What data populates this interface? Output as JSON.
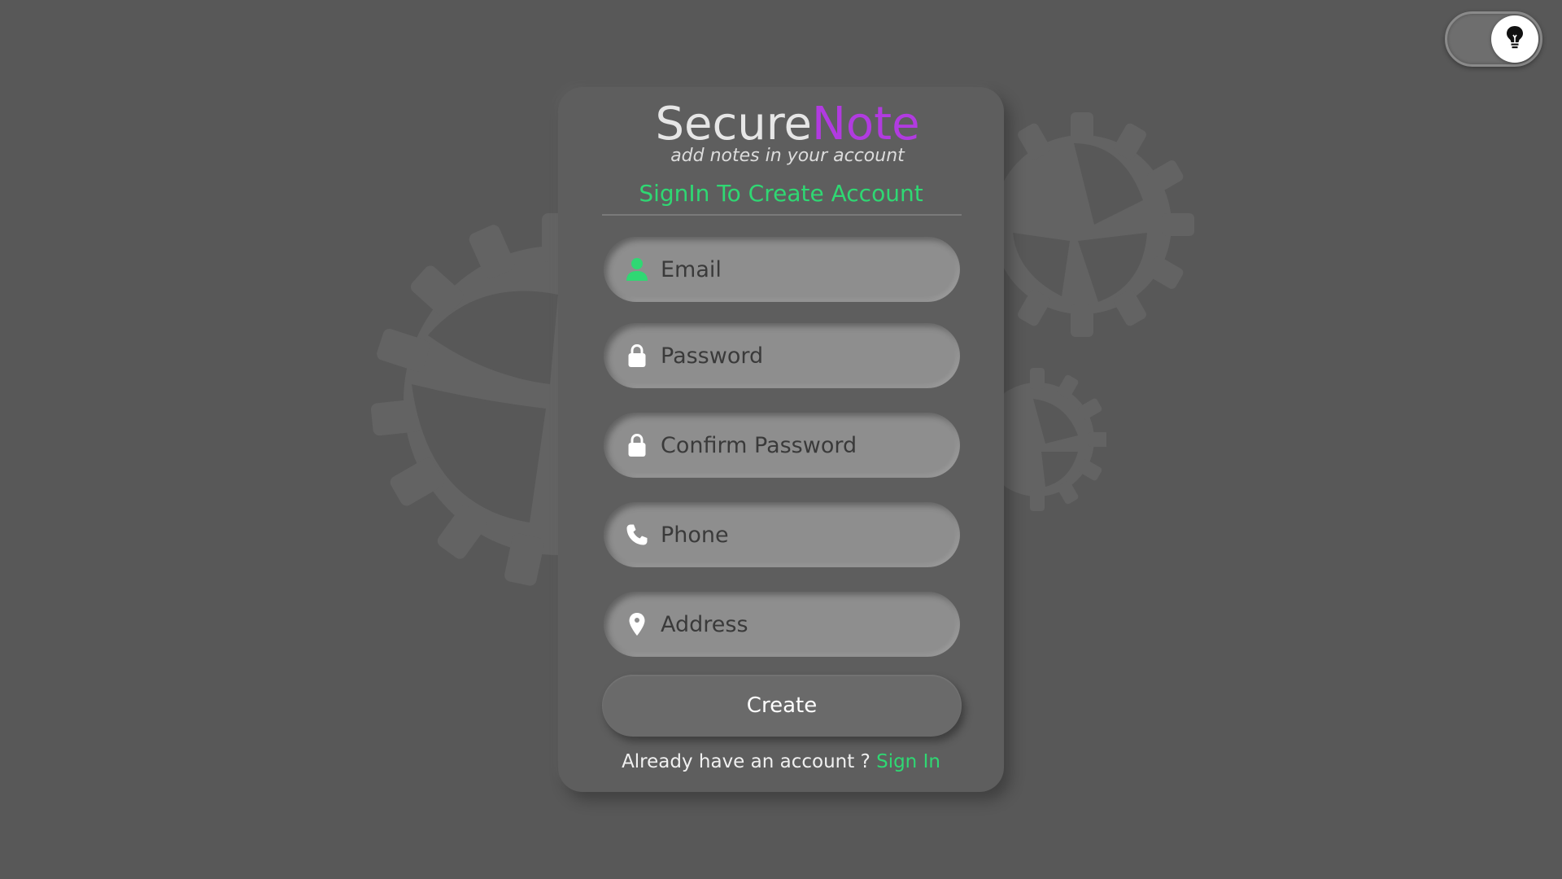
{
  "brand": {
    "part1": "Secure",
    "part2": "Note",
    "tagline": "add notes in your account"
  },
  "form": {
    "heading": "SignIn To Create Account",
    "fields": [
      {
        "name": "email",
        "placeholder": "Email",
        "icon": "user-icon"
      },
      {
        "name": "password",
        "placeholder": "Password",
        "icon": "lock-icon"
      },
      {
        "name": "confirm-password",
        "placeholder": "Confirm Password",
        "icon": "lock-icon"
      },
      {
        "name": "phone",
        "placeholder": "Phone",
        "icon": "phone-icon"
      },
      {
        "name": "address",
        "placeholder": "Address",
        "icon": "location-pin-icon"
      }
    ],
    "submit_label": "Create",
    "footer_text": "Already have an account ? ",
    "footer_link": "Sign In"
  },
  "theme_toggle": {
    "icon": "lightbulb-icon"
  },
  "colors": {
    "background": "#585858",
    "card": "#5e5e5e",
    "accent_green": "#2fd873",
    "brand_purple": "#b13be0",
    "field": "#8e8e8e"
  }
}
